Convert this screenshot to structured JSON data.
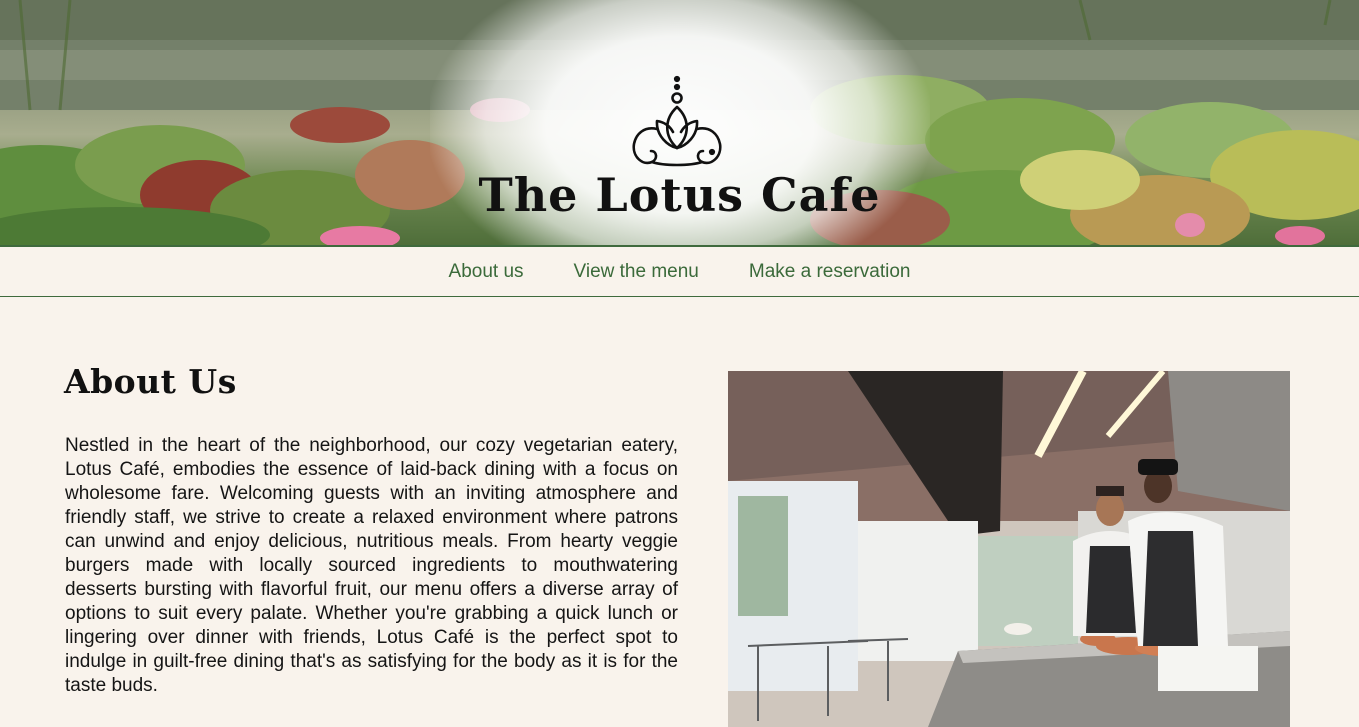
{
  "brand": {
    "title": "The Lotus Cafe",
    "logo": "lotus-icon"
  },
  "nav": {
    "items": [
      {
        "label": "About us"
      },
      {
        "label": "View the menu"
      },
      {
        "label": "Make a reservation"
      }
    ]
  },
  "about": {
    "heading": "About Us",
    "body": "Nestled in the heart of the neighborhood, our cozy vegetarian eatery, Lotus Café, embodies the essence of laid-back dining with a focus on wholesome fare. Welcoming guests with an inviting atmosphere and friendly staff, we strive to create a relaxed environment where patrons can unwind and enjoy delicious, nutritious meals. From hearty veggie burgers made with locally sourced ingredients to mouthwatering desserts bursting with flavorful fruit, our menu offers a diverse array of options to suit every palate. Whether you're grabbing a quick lunch or lingering over dinner with friends, Lotus Café is the perfect spot to indulge in guilt-free dining that's as satisfying for the body as it is for the taste buds.",
    "photo": "kitchen-chefs-photo"
  },
  "colors": {
    "background": "#f9f3ec",
    "nav_link": "#3b6a3a",
    "nav_border": "#3f6a3d",
    "text": "#151515"
  }
}
